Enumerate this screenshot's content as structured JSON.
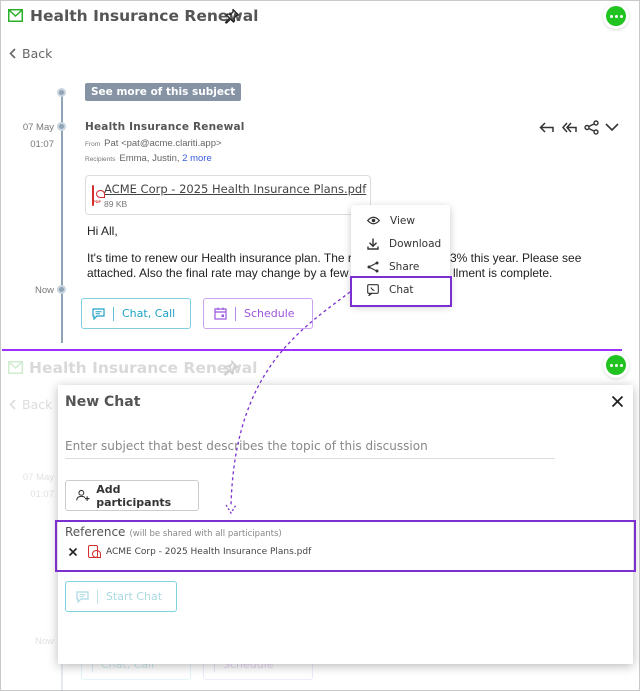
{
  "thread": {
    "title": "Health Insurance Renewal",
    "back_label": "Back",
    "see_more_label": "See more of this subject",
    "date_label": "07 May",
    "time_label": "01:07",
    "now_label": "Now"
  },
  "message": {
    "sender_name": "Health Insurance Renewal",
    "from_key": "From",
    "from_value": "Pat <pat@acme.clariti.app>",
    "recipients_key": "Recipients",
    "recipients_value": "Emma, Justin,",
    "recipients_more": "2 more",
    "attachment": {
      "name": "ACME Corp - 2025 Health Insurance Plans.pdf",
      "size": "89 KB",
      "icon": "pdf-icon"
    },
    "greeting": "Hi All,",
    "body_line1_a": "It's time to renew our Health insurance plan.  The rat",
    "body_line1_b": "3% this year.  Please see",
    "body_line2_a": "attached.  Also the final rate may change by a few de",
    "body_line2_b": "llment is complete."
  },
  "actions": {
    "chat_call_label": "Chat, Call",
    "schedule_label": "Schedule"
  },
  "attachment_menu": {
    "items": [
      {
        "label": "View",
        "icon": "eye-icon"
      },
      {
        "label": "Download",
        "icon": "download-icon"
      },
      {
        "label": "Share",
        "icon": "share-icon"
      },
      {
        "label": "Chat",
        "icon": "chat-icon"
      }
    ]
  },
  "new_chat": {
    "title": "New Chat",
    "subject_placeholder": "Enter subject that best describes the topic of this discussion",
    "add_participants_label": "Add participants",
    "reference_label": "Reference",
    "reference_note": "(will be shared with all participants)",
    "reference_file": "ACME Corp - 2025 Health Insurance Plans.pdf",
    "start_chat_label": "Start Chat"
  },
  "background": {
    "chat_call_label": "Chat, Call",
    "schedule_label": "Schedule"
  },
  "colors": {
    "accent_purple": "#7b2fd0",
    "chat_cyan": "#1fa2c4",
    "schedule_violet": "#9a55e0",
    "fab_green": "#21c321",
    "timeline": "#90a4b8"
  }
}
